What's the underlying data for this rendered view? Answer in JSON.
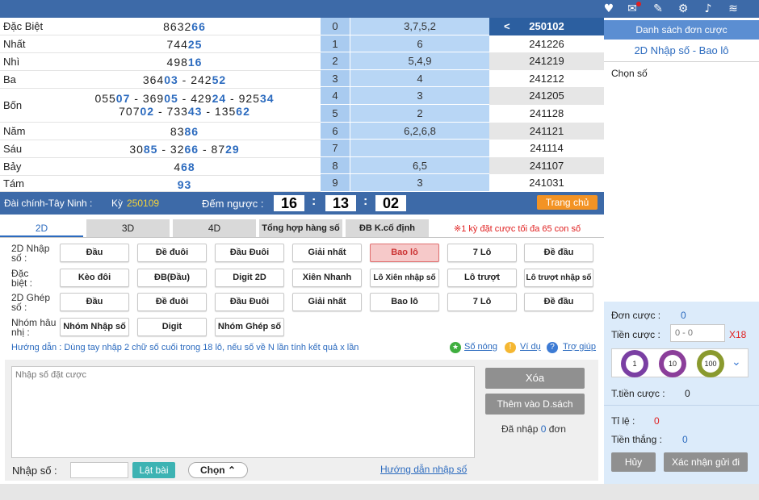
{
  "results": [
    {
      "name": "Đặc Biệt",
      "pre": "8632",
      "hl": "66"
    },
    {
      "name": "Nhất",
      "pre": "744",
      "hl": "25"
    },
    {
      "name": "Nhì",
      "pre": "498",
      "hl": "16"
    },
    {
      "name": "Ba",
      "pre": "364",
      "hl": "03",
      "pre2": "242",
      "hl2": "52"
    },
    {
      "name": "Bốn",
      "line1": [
        [
          "055",
          "07"
        ],
        [
          "369",
          "05"
        ],
        [
          "429",
          "24"
        ],
        [
          "925",
          "34"
        ]
      ],
      "line2": [
        [
          "707",
          "02"
        ],
        [
          "733",
          "43"
        ],
        [
          "135",
          "62"
        ]
      ]
    },
    {
      "name": "Năm",
      "pre": "83",
      "hl": "86"
    },
    {
      "name": "Sáu",
      "line1": [
        [
          "30",
          "85"
        ],
        [
          "32",
          "66"
        ],
        [
          "87",
          "29"
        ]
      ]
    },
    {
      "name": "Bảy",
      "pre": "4",
      "hl": "68"
    },
    {
      "name": "Tám",
      "pre": "",
      "hl": "93"
    }
  ],
  "loto": [
    {
      "d": "0",
      "v": "3,7,5,2"
    },
    {
      "d": "1",
      "v": "6"
    },
    {
      "d": "2",
      "v": "5,4,9"
    },
    {
      "d": "3",
      "v": "4"
    },
    {
      "d": "4",
      "v": "3"
    },
    {
      "d": "5",
      "v": "2"
    },
    {
      "d": "6",
      "v": "6,2,6,8"
    },
    {
      "d": "7",
      "v": ""
    },
    {
      "d": "8",
      "v": "6,5"
    },
    {
      "d": "9",
      "v": "3"
    }
  ],
  "periods": [
    "250102",
    "241226",
    "241219",
    "241212",
    "241205",
    "241128",
    "241121",
    "241114",
    "241107",
    "241031"
  ],
  "info": {
    "station": "Đài chính-Tây Ninh :",
    "ky_label": "Kỳ",
    "ky_value": "250109",
    "countdown_label": "Đếm ngược :",
    "hh": "16",
    "mm": "13",
    "ss": "02",
    "home_label": "Trang chủ"
  },
  "tabs": [
    "2D",
    "3D",
    "4D",
    "Tổng hợp hàng số",
    "ĐB K.cố định"
  ],
  "limit_note": "※1 kỳ đặt cược tối đa 65 con số",
  "groups": [
    {
      "label1": "2D Nhập",
      "label2": "số :",
      "buttons": [
        "Đầu",
        "Đề đuôi",
        "Đầu Đuôi",
        "Giải nhất",
        "Bao lô",
        "7 Lô",
        "Đề đầu"
      ]
    },
    {
      "label1": "Đặc",
      "label2": "biệt :",
      "buttons": [
        "Kèo đôi",
        "ĐB(Đầu)",
        "Digit 2D",
        "Xiên Nhanh",
        "Lô Xiên nhập số",
        "Lô trượt",
        "Lô trượt nhập số"
      ]
    },
    {
      "label1": "2D Ghép",
      "label2": "số :",
      "buttons": [
        "Đầu",
        "Đề đuôi",
        "Đầu Đuôi",
        "Giải nhất",
        "Bao lô",
        "7 Lô",
        "Đề đầu"
      ]
    },
    {
      "label1": "Nhóm hâu",
      "label2": "nhị :",
      "buttons": [
        "Nhóm Nhập số",
        "Digit",
        "Nhóm Ghép số"
      ]
    }
  ],
  "guide": "Hướng dẫn : Dùng tay nhập 2 chữ số cuối trong 18 lô, nếu số về N lần tính kết quả x lần",
  "links": {
    "hot": "Số nóng",
    "example": "Ví dụ",
    "help": "Trợ giúp",
    "input_guide": "Hướng dẫn nhập số"
  },
  "textarea_placeholder": "Nhập số đặt cược",
  "clear_label": "Xóa",
  "add_label": "Thêm vào D.sách",
  "entered": {
    "pre": "Đã nhập",
    "count": "0",
    "post": "đơn"
  },
  "input_label": "Nhập số :",
  "flip_label": "Lật bài",
  "choose_label": "Chọn",
  "right": {
    "header": "Danh sách đơn cược",
    "subtitle": "2D Nhập số - Bao lô",
    "choose": "Chọn số",
    "order_label": "Đơn cược :",
    "order_count": "0",
    "amount_label": "Tiền cược :",
    "amount_placeholder": "0 - 0",
    "multiplier": "X18",
    "chips": [
      "1",
      "10",
      "100"
    ],
    "total_label": "T.tiền cược :",
    "total_value": "0",
    "rate_label": "Tỉ lệ :",
    "rate_value": "0",
    "win_label": "Tiền thắng :",
    "win_value": "0",
    "cancel": "Hủy",
    "confirm": "Xác nhận gửi đi"
  },
  "colors": {
    "accent": "#3d6aa8",
    "highlight": "#2c6bbf",
    "orange": "#f39324",
    "red": "#e02020"
  }
}
